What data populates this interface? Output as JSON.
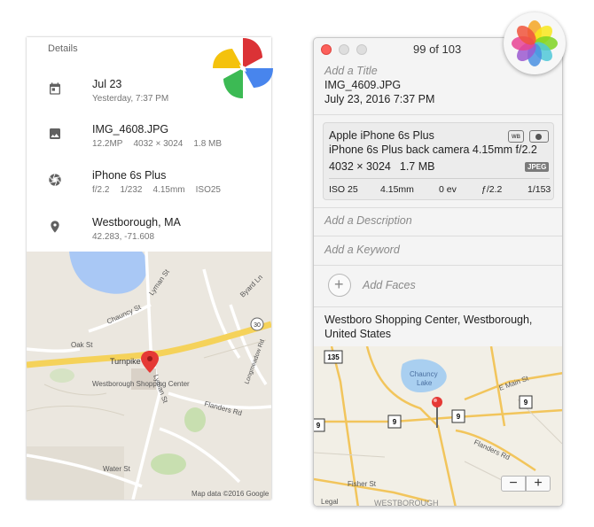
{
  "google_photos": {
    "header": "Details",
    "date": {
      "icon": "calendar-icon",
      "title": "Jul 23",
      "subtitle": "Yesterday, 7:37 PM"
    },
    "file": {
      "icon": "image-icon",
      "title": "IMG_4608.JPG",
      "megapixels": "12.2MP",
      "dimensions": "4032 × 3024",
      "size": "1.8 MB"
    },
    "camera": {
      "icon": "aperture-icon",
      "title": "iPhone 6s Plus",
      "aperture": "f/2.2",
      "shutter": "1/232",
      "focal": "4.15mm",
      "iso": "ISO25"
    },
    "location": {
      "icon": "location-pin-icon",
      "title": "Westborough, MA",
      "coords": "42.283, -71.608"
    },
    "map": {
      "labels": {
        "lyman_st_n": "Lyman St",
        "chauncy_st": "Chauncy St",
        "byard_ln": "Byard Ln",
        "oak_st": "Oak St",
        "route": "30",
        "turnpike": "Turnpike",
        "longmeadow": "Longmeadow Rd",
        "lyman_st_s": "Lyman St",
        "shopping_center": "Westborough Shopping Center",
        "flanders_rd": "Flanders Rd",
        "water_st": "Water St"
      },
      "attribution": "Map data ©2016 Google"
    }
  },
  "mac_photos": {
    "counter": "99 of 103",
    "add_title": "Add a Title",
    "filename": "IMG_4609.JPG",
    "datetime": "July 23, 2016   7:37 PM",
    "card": {
      "model": "Apple iPhone 6s Plus",
      "lens": "iPhone 6s Plus back camera 4.15mm f/2.2",
      "dimensions": "4032 × 3024",
      "size": "1.7 MB",
      "wb_label": "WB",
      "format": "JPEG",
      "iso": "ISO 25",
      "focal": "4.15mm",
      "ev": "0 ev",
      "aperture": "ƒ/2.2",
      "shutter": "1/153"
    },
    "add_description": "Add a Description",
    "add_keyword": "Add a Keyword",
    "add_faces": "Add Faces",
    "location": "Westboro Shopping Center, Westborough, United States",
    "map": {
      "labels": {
        "route135": "135",
        "chauncy": "Chauncy",
        "lake": "Lake",
        "e_main": "E Main St",
        "route9a": "9",
        "route9b": "9",
        "route9c": "9",
        "route9d": "9",
        "flanders": "Flanders Rd",
        "fisher": "Fisher St",
        "town": "WESTBOROUGH",
        "legal": "Legal"
      },
      "zoom_out": "−",
      "zoom_in": "+"
    }
  },
  "colors": {
    "google_yellow": "#f4c20d",
    "google_red": "#db3236",
    "google_blue": "#4885ed",
    "google_green": "#3cba54",
    "mac_close": "#fc605b"
  }
}
